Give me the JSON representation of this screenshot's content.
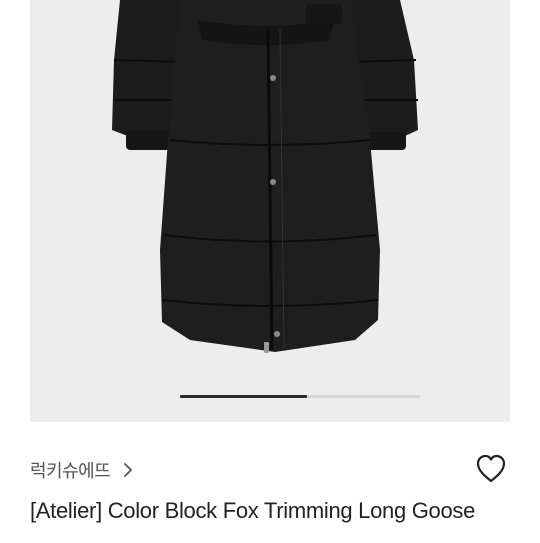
{
  "product": {
    "brand_name": "럭키슈에뜨",
    "title": "[Atelier] Color Block Fox Trimming Long Goose",
    "image_alt": "Black long goose down padded coat"
  },
  "gallery": {
    "slide_progress": 0.53
  },
  "icons": {
    "brand_chevron": "chevron-right-icon",
    "wishlist": "heart-outline-icon"
  },
  "colors": {
    "gallery_background": "#ededed",
    "text_primary": "#222222",
    "text_brand": "#555555",
    "indicator_active": "#2a2a2a",
    "indicator_track": "#d6d6d6"
  }
}
